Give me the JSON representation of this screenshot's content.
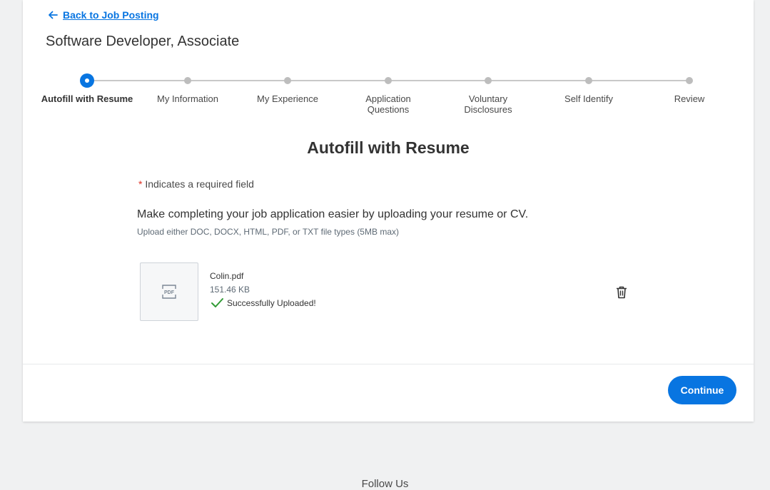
{
  "back_link": {
    "label": "Back to Job Posting"
  },
  "job_title": "Software Developer, Associate",
  "stepper": {
    "steps": [
      {
        "label": "Autofill with Resume",
        "active": true
      },
      {
        "label": "My Information",
        "active": false
      },
      {
        "label": "My Experience",
        "active": false
      },
      {
        "label": "Application Questions",
        "active": false
      },
      {
        "label": "Voluntary Disclosures",
        "active": false
      },
      {
        "label": "Self Identify",
        "active": false
      },
      {
        "label": "Review",
        "active": false
      }
    ]
  },
  "section": {
    "title": "Autofill with Resume",
    "required_star": "*",
    "required_note": "Indicates a required field",
    "lead": "Make completing your job application easier by uploading your resume or CV.",
    "hint": "Upload either DOC, DOCX, HTML, PDF, or TXT file types (5MB max)"
  },
  "file": {
    "thumb_label": "PDF",
    "name": "Colin.pdf",
    "size": "151.46 KB",
    "status": "Successfully Uploaded!"
  },
  "footer": {
    "continue_label": "Continue"
  },
  "page_footer": {
    "follow_us": "Follow Us"
  },
  "colors": {
    "accent": "#0875e1",
    "success": "#319b35",
    "required": "#de2e21"
  },
  "icons": {
    "back": "arrow-left-icon",
    "file": "pdf-file-icon",
    "status": "checkmark-icon",
    "delete": "trash-icon"
  }
}
